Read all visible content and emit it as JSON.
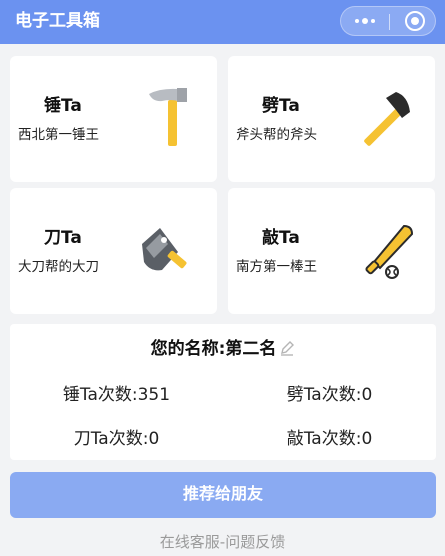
{
  "navbar": {
    "title": "电子工具箱"
  },
  "tools": [
    {
      "title": "锤Ta",
      "subtitle": "西北第一锤王",
      "icon": "hammer-icon"
    },
    {
      "title": "劈Ta",
      "subtitle": "斧头帮的斧头",
      "icon": "axe-icon"
    },
    {
      "title": "刀Ta",
      "subtitle": "大刀帮的大刀",
      "icon": "cleaver-icon"
    },
    {
      "title": "敲Ta",
      "subtitle": "南方第一棒王",
      "icon": "baseball-bat-icon"
    }
  ],
  "stats": {
    "name_label": "您的名称:第二名",
    "hammer": "锤Ta次数:351",
    "axe": "劈Ta次数:0",
    "knife": "刀Ta次数:0",
    "bat": "敲Ta次数:0"
  },
  "share_button": "推荐给朋友",
  "feedback_link": "在线客服-问题反馈",
  "colors": {
    "navbar": "#6b92f0",
    "button": "#8aaaf2",
    "tool_yellow": "#f5c232"
  }
}
